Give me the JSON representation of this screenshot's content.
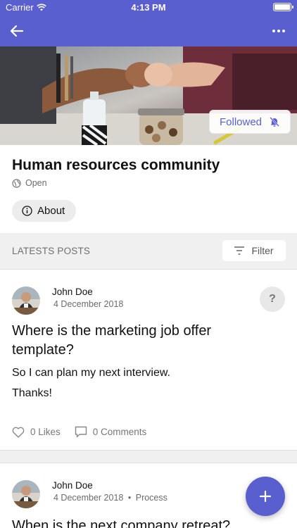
{
  "status_bar": {
    "carrier": "Carrier",
    "time": "4:13 PM"
  },
  "app_bar": {
    "back_icon": "arrow-left-icon",
    "more_icon": "more-horizontal-icon"
  },
  "banner": {
    "followed_label": "Followed",
    "bell_icon": "bell-off-icon"
  },
  "group": {
    "title": "Human resources community",
    "visibility": "Open",
    "about_label": "About"
  },
  "posts_section": {
    "title": "LATESTS POSTS",
    "filter_label": "Filter"
  },
  "posts": [
    {
      "author": "John Doe",
      "date": "4 December 2018",
      "category": "",
      "badge": "?",
      "title": "Where is the marketing job offer template?",
      "body": [
        "So I can plan my next interview.",
        "Thanks!"
      ],
      "likes": "0 Likes",
      "comments": "0 Comments"
    },
    {
      "author": "John Doe",
      "date": "4 December 2018",
      "separator": "•",
      "category": "Process",
      "title": "When is the next company retreat?"
    }
  ],
  "colors": {
    "primary": "#5a5fcf",
    "section_bg": "#f0f0f0"
  }
}
